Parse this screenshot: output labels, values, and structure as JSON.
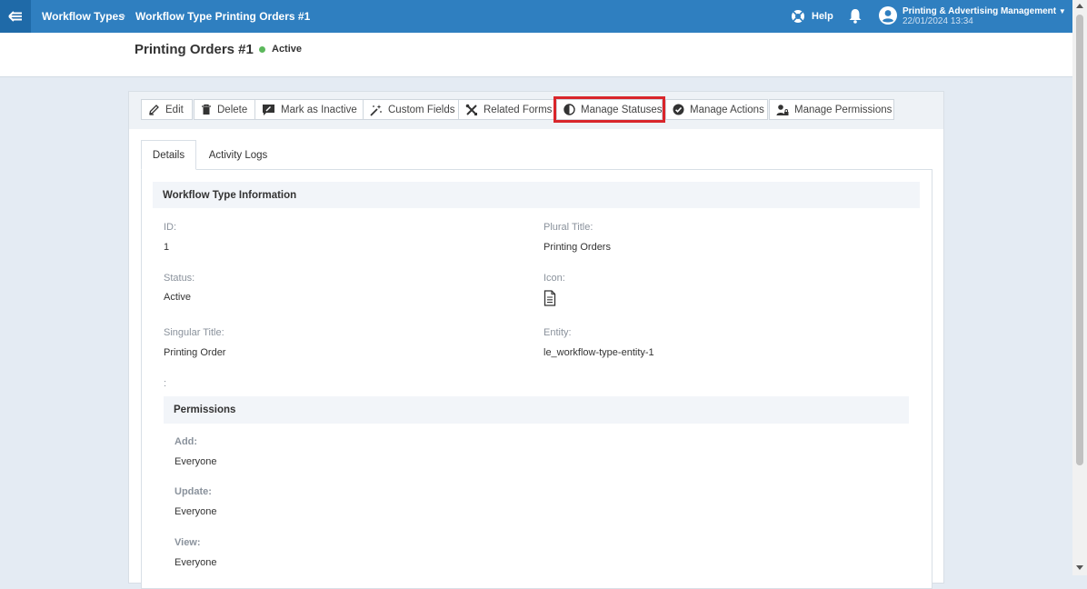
{
  "header": {
    "breadcrumb": [
      "Workflow Types",
      "Workflow Type Printing Orders #1"
    ],
    "breadcrumb_separator": "›",
    "help_label": "Help",
    "user_name": "Printing & Advertising Management",
    "user_date": "22/01/2024 13:34"
  },
  "page": {
    "title": "Printing Orders #1",
    "status": "Active",
    "status_color": "#5cb85c"
  },
  "toolbar": {
    "edit": "Edit",
    "delete": "Delete",
    "mark_inactive": "Mark as Inactive",
    "custom_fields": "Custom Fields",
    "related_forms": "Related Forms",
    "manage_statuses": "Manage Statuses",
    "manage_actions": "Manage Actions",
    "manage_permissions": "Manage Permissions"
  },
  "tabs": [
    "Details",
    "Activity Logs"
  ],
  "details": {
    "section_title": "Workflow Type Information",
    "id_label": "ID:",
    "id_value": "1",
    "plural_label": "Plural Title:",
    "plural_value": "Printing Orders",
    "status_label": "Status:",
    "status_value": "Active",
    "icon_label": "Icon:",
    "icon_value": "document-icon",
    "singular_label": "Singular Title:",
    "singular_value": "Printing Order",
    "entity_label": "Entity:",
    "entity_value": "le_workflow-type-entity-1",
    "stray_colon": ":"
  },
  "permissions": {
    "title": "Permissions",
    "add_label": "Add:",
    "add_value": "Everyone",
    "update_label": "Update:",
    "update_value": "Everyone",
    "view_label": "View:",
    "view_value": "Everyone"
  },
  "colors": {
    "topbar": "#2f7fc0",
    "highlight": "#d9262b"
  }
}
